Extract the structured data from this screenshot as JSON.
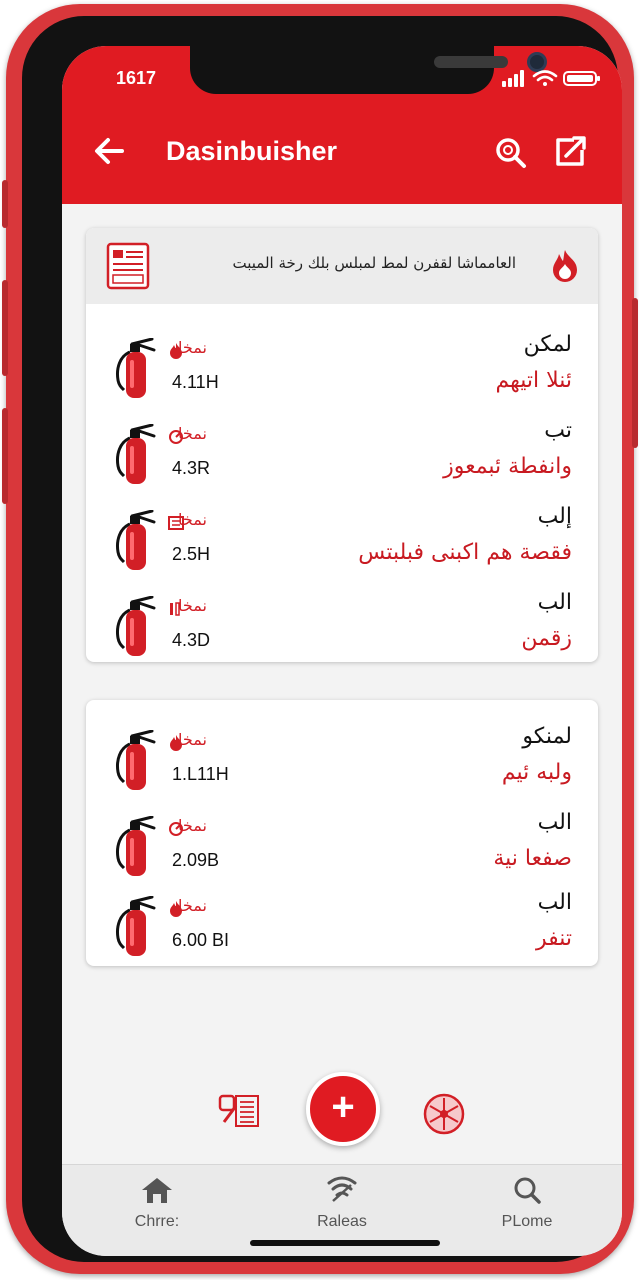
{
  "status_bar": {
    "time": "1617"
  },
  "header": {
    "title": "Dasinbuisher"
  },
  "card1": {
    "header_text": "العامماشا لقفرن لمط لمبلس بلك رخة الميبت",
    "rows": [
      {
        "code": "نمخا",
        "value": "4.11H",
        "heading": "لمكن",
        "sub": "ئنلا اتيهم"
      },
      {
        "code": "نمخا",
        "value": "4.3R",
        "heading": "تب",
        "sub": "وانفطة ئبمعوز"
      },
      {
        "code": "نمخا",
        "value": "2.5H",
        "heading": "إلب",
        "sub": "فقصة هم اكبنى فبلبتس"
      },
      {
        "code": "نمخا",
        "value": "4.3D",
        "heading": "الب",
        "sub": "زقمن"
      }
    ]
  },
  "card2": {
    "rows": [
      {
        "code": "نمخا",
        "value": "1.L11H",
        "heading": "لمنكو",
        "sub": "ولبه ئيم"
      },
      {
        "code": "نمخا",
        "value": "2.09B",
        "heading": "الب",
        "sub": "صفعا نية"
      },
      {
        "code": "نمخا",
        "value": "6.00 BI",
        "heading": "الب",
        "sub": "تنفر"
      }
    ]
  },
  "fab": {
    "symbol": "+"
  },
  "bottom_nav": {
    "items": [
      {
        "label": "Chrre:",
        "icon": "home-icon"
      },
      {
        "label": "Raleas",
        "icon": "signal-icon"
      },
      {
        "label": "PLome",
        "icon": "search-icon"
      }
    ]
  },
  "colors": {
    "brand_red": "#e01b22",
    "screen_bg": "#f3f3f3",
    "frame": "#d9373b"
  }
}
